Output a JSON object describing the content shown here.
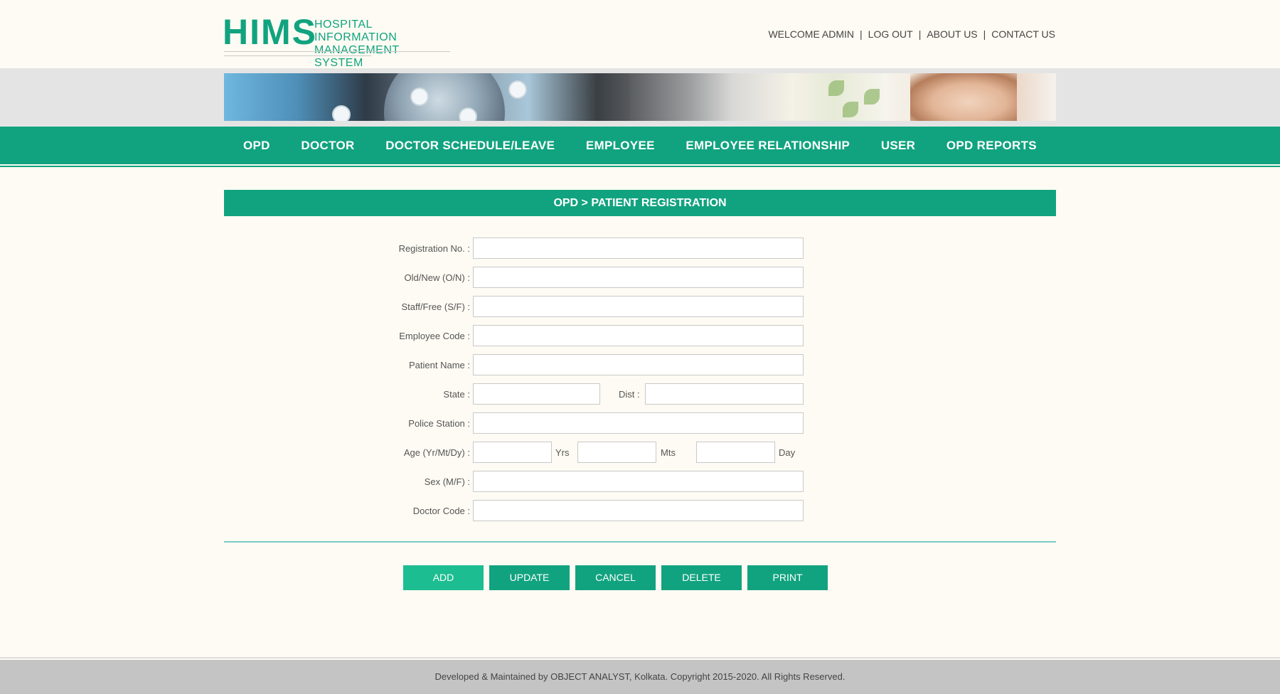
{
  "logo": {
    "mark": "HIMS",
    "line1": "HOSPITAL INFORMATION",
    "line2": "MANAGEMENT SYSTEM"
  },
  "top_links": {
    "welcome": "WELCOME ADMIN",
    "logout": "LOG OUT",
    "about": "ABOUT US",
    "contact": "CONTACT US",
    "separator": "|"
  },
  "nav": {
    "items": [
      {
        "label": "OPD"
      },
      {
        "label": "DOCTOR"
      },
      {
        "label": "DOCTOR SCHEDULE/LEAVE"
      },
      {
        "label": "EMPLOYEE"
      },
      {
        "label": "EMPLOYEE RELATIONSHIP"
      },
      {
        "label": "USER"
      },
      {
        "label": "OPD REPORTS"
      }
    ]
  },
  "page": {
    "title": "OPD > PATIENT REGISTRATION"
  },
  "form": {
    "registration_no": {
      "label": "Registration No. :",
      "value": ""
    },
    "old_new": {
      "label": "Old/New (O/N) :",
      "value": ""
    },
    "staff_free": {
      "label": "Staff/Free (S/F) :",
      "value": ""
    },
    "employee_code": {
      "label": "Employee Code :",
      "value": ""
    },
    "patient_name": {
      "label": "Patient Name :",
      "value": ""
    },
    "state": {
      "label": "State :",
      "value": ""
    },
    "dist": {
      "label": "Dist :",
      "value": ""
    },
    "police_station": {
      "label": "Police Station :",
      "value": ""
    },
    "age": {
      "label": "Age (Yr/Mt/Dy) :",
      "years_unit": "Yrs",
      "months_unit": "Mts",
      "days_unit": "Day",
      "years": "",
      "months": "",
      "days": ""
    },
    "sex": {
      "label": "Sex (M/F) :",
      "value": ""
    },
    "doctor_code": {
      "label": "Doctor Code :",
      "value": ""
    }
  },
  "buttons": {
    "add": "ADD",
    "update": "UPDATE",
    "cancel": "CANCEL",
    "delete": "DELETE",
    "print": "PRINT"
  },
  "footer": {
    "text": "Developed & Maintained by OBJECT ANALYST, Kolkata. Copyright 2015-2020. All Rights Reserved."
  },
  "colors": {
    "primary": "#11a37f",
    "active_button": "#1cbd91",
    "background": "#fdfbf3",
    "footer": "#c4c4c4"
  }
}
